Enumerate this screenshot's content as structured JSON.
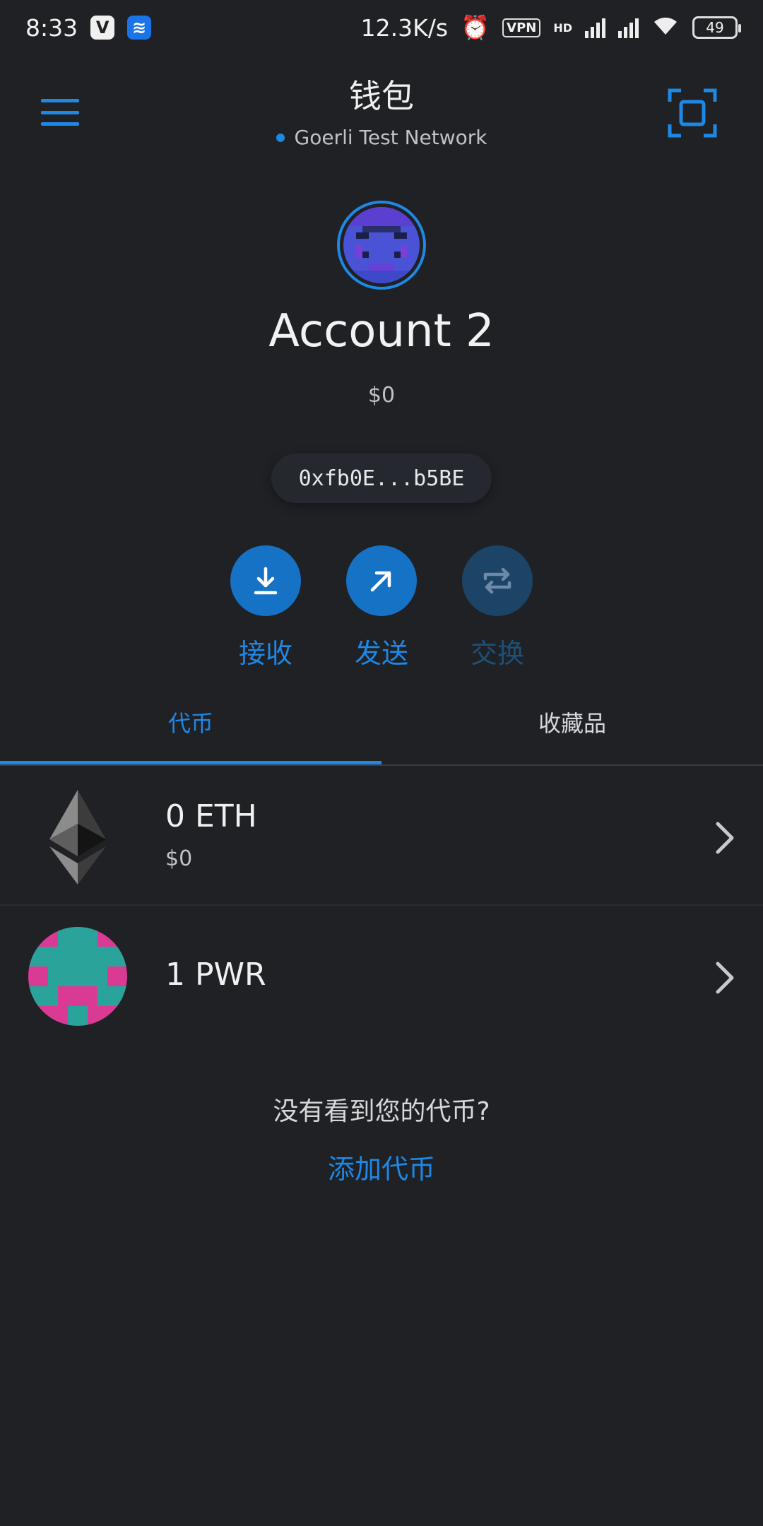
{
  "status_bar": {
    "time": "8:33",
    "speed": "12.3K/s",
    "vpn": "VPN",
    "hd": "HD",
    "battery": "49"
  },
  "header": {
    "title": "钱包",
    "network": "Goerli Test Network"
  },
  "account": {
    "name": "Account 2",
    "balance": "$0",
    "address": "0xfb0E...b5BE"
  },
  "actions": [
    {
      "label": "接收",
      "icon": "download-icon",
      "enabled": true
    },
    {
      "label": "发送",
      "icon": "send-arrow-icon",
      "enabled": true
    },
    {
      "label": "交换",
      "icon": "swap-icon",
      "enabled": false
    }
  ],
  "tabs": [
    {
      "label": "代币",
      "active": true
    },
    {
      "label": "收藏品",
      "active": false
    }
  ],
  "tokens": [
    {
      "amount": "0 ETH",
      "fiat": "$0",
      "icon": "ethereum-icon"
    },
    {
      "amount": "1 PWR",
      "icon": "pwr-token-icon"
    }
  ],
  "footer": {
    "no_token_text": "没有看到您的代币?",
    "add_token": "添加代币"
  },
  "colors": {
    "background": "#1f2125",
    "accent": "#1e88e5"
  }
}
